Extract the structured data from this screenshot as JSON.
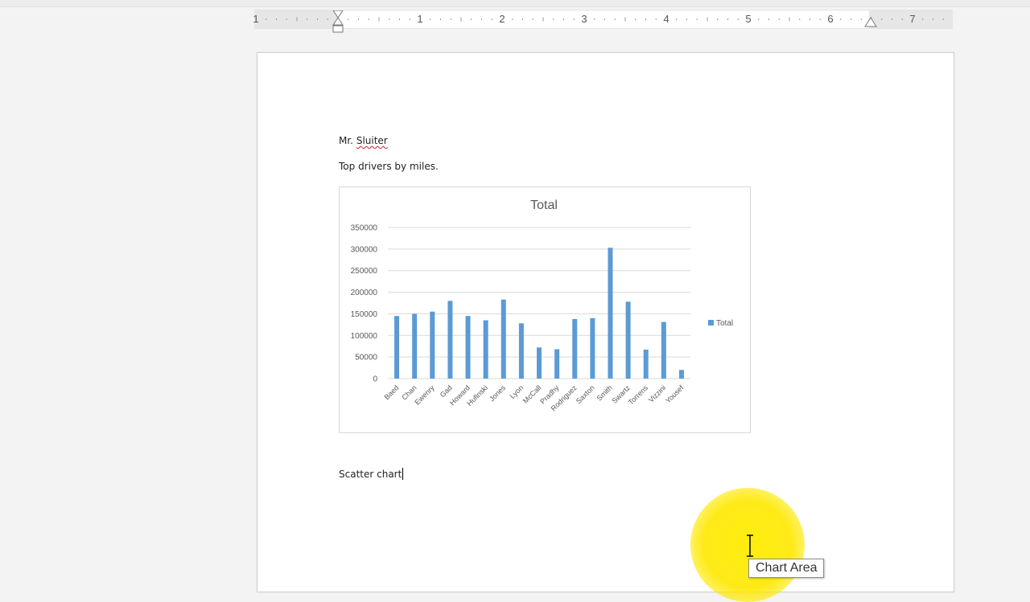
{
  "ruler": {
    "numbers": [
      "1",
      "1",
      "2",
      "3",
      "4",
      "5",
      "6",
      "7"
    ]
  },
  "document": {
    "line1_prefix": "Mr. ",
    "line1_name": "Sluiter",
    "line2": "Top drivers by miles.",
    "line3": "Scatter chart"
  },
  "tooltip": {
    "text": "Chart Area"
  },
  "chart_data": {
    "type": "bar",
    "title": "Total",
    "xlabel": "",
    "ylabel": "",
    "ylim": [
      0,
      350000
    ],
    "yticks": [
      "0",
      "50000",
      "100000",
      "150000",
      "200000",
      "250000",
      "300000",
      "350000"
    ],
    "categories": [
      "Baed",
      "Chan",
      "Ewenry",
      "Gad",
      "Howard",
      "Hufinski",
      "Jones",
      "Lyon",
      "McCall",
      "Pradhy",
      "Rodriguez",
      "Saxton",
      "Smith",
      "Swartz",
      "Torrens",
      "Vizzini",
      "Yousef"
    ],
    "series": [
      {
        "name": "Total",
        "values": [
          145000,
          150000,
          155000,
          180000,
          145000,
          135000,
          183000,
          128000,
          72000,
          68000,
          138000,
          140000,
          303000,
          178000,
          67000,
          131000,
          20000
        ]
      }
    ],
    "grid": true,
    "legend": "right",
    "colors": {
      "bar": "#5b9bd5",
      "grid": "#d9d9d9",
      "text": "#595959"
    }
  }
}
